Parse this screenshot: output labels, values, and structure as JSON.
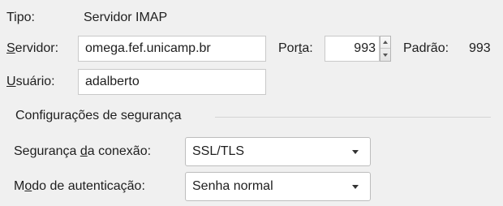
{
  "account": {
    "type_label": "Tipo:",
    "type_value": "Servidor IMAP",
    "server_label_accel": "S",
    "server_label_rest": "ervidor:",
    "server_value": "omega.fef.unicamp.br",
    "port_label_pre": "Por",
    "port_label_accel": "t",
    "port_label_post": "a:",
    "port_value": "993",
    "default_label": "Padrão:",
    "default_value": "993",
    "user_label_accel": "U",
    "user_label_rest": "suário:",
    "user_value": "adalberto"
  },
  "security": {
    "group_title": "Configurações de segurança",
    "connection_label_pre": "Segurança ",
    "connection_label_accel": "d",
    "connection_label_post": "a conexão:",
    "connection_value": "SSL/TLS",
    "auth_label_pre": "M",
    "auth_label_accel": "o",
    "auth_label_post": "do de autenticação:",
    "auth_value": "Senha normal"
  },
  "icons": {
    "spin_up": "triangle-up",
    "spin_down": "triangle-down",
    "dropdown": "chevron-down"
  }
}
